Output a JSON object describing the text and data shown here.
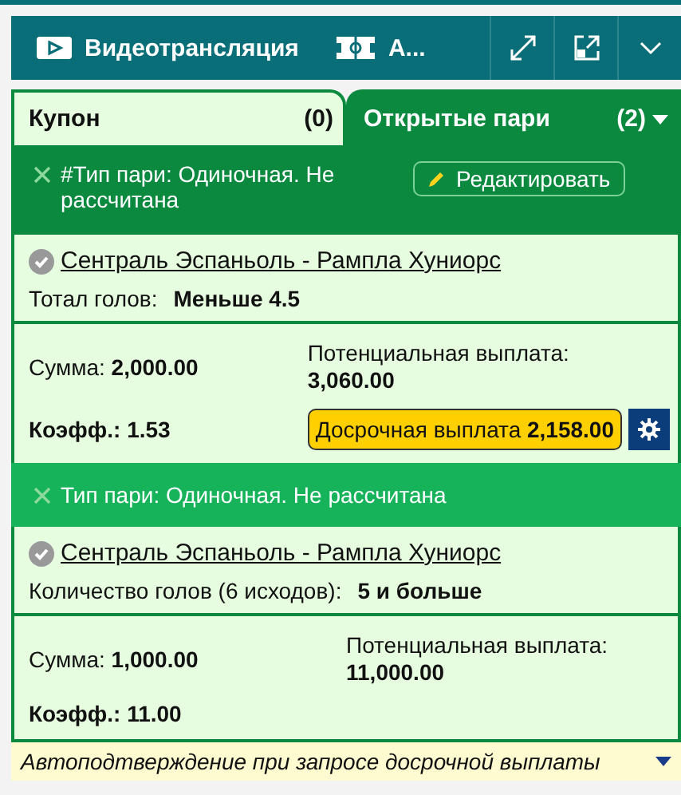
{
  "toolbar": {
    "video_label": "Видеотрансляция",
    "second_label": "А..."
  },
  "tabs": [
    {
      "label": "Купон",
      "count": "(0)",
      "selected": false
    },
    {
      "label": "Открытые пари",
      "count": "(2)",
      "selected": true
    }
  ],
  "bets": [
    {
      "selected": true,
      "number": "#",
      "status": "Тип пари: Одиночная. Не рассчитана",
      "edit_button": "Редактировать",
      "event": "Сентраль Эспаньоль - Рампла Хуниорс",
      "market": "Тотал голов:",
      "selection": "Меньше 4.5",
      "stake_label": "Сумма:",
      "stake": "2,000.00",
      "payout_label": "Потенциальная выплата:",
      "payout": "3,060.00",
      "odds_label": "Коэфф.:",
      "odds": "1.53",
      "cashout_label": "Досрочная выплата",
      "cashout": "2,158.00"
    },
    {
      "selected": false,
      "status": "Тип пари: Одиночная. Не рассчитана",
      "event": "Сентраль Эспаньоль - Рампла Хуниорс",
      "market": "Количество голов (6 исходов):",
      "selection": "5 и больше",
      "stake_label": "Сумма:",
      "stake": "1,000.00",
      "payout_label": "Потенциальная выплата:",
      "payout": "11,000.00",
      "odds_label": "Коэфф.:",
      "odds": "11.00"
    }
  ],
  "footer": "Автоподтверждение при запросе досрочной выплаты"
}
